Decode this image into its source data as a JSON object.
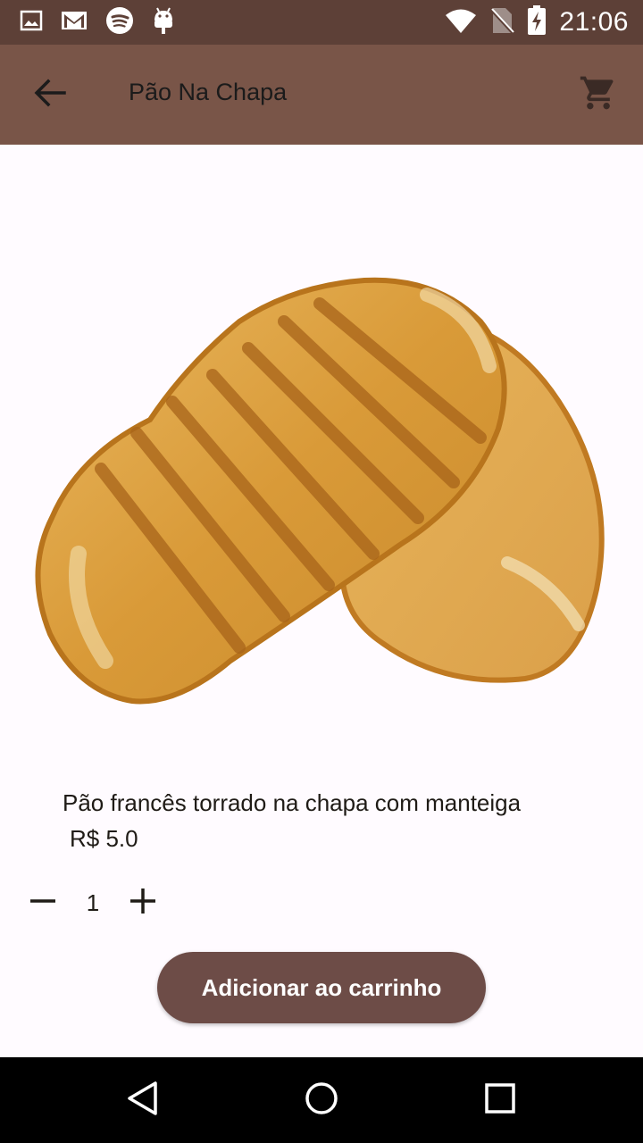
{
  "status_bar": {
    "time": "21:06",
    "left_icons": [
      "image-icon",
      "gmail-icon",
      "spotify-icon",
      "android-icon"
    ],
    "right_icons": [
      "wifi-icon",
      "no-sim-icon",
      "battery-charging-icon"
    ]
  },
  "app_bar": {
    "title": "Pão Na Chapa",
    "back_icon": "arrow-back-icon",
    "cart_icon": "shopping-cart-icon"
  },
  "product": {
    "image": "toasted-bread-image",
    "description": "Pão francês torrado na chapa com manteiga",
    "price": "R$ 5.0",
    "quantity": "1"
  },
  "actions": {
    "add_to_cart_label": "Adicionar ao carrinho"
  },
  "nav_bar": {
    "icons": [
      "back-triangle-icon",
      "home-circle-icon",
      "recents-square-icon"
    ]
  },
  "colors": {
    "status_bar": "#5d4037",
    "app_bar": "#795548",
    "button": "#6d4c47",
    "background": "#fffbff"
  }
}
